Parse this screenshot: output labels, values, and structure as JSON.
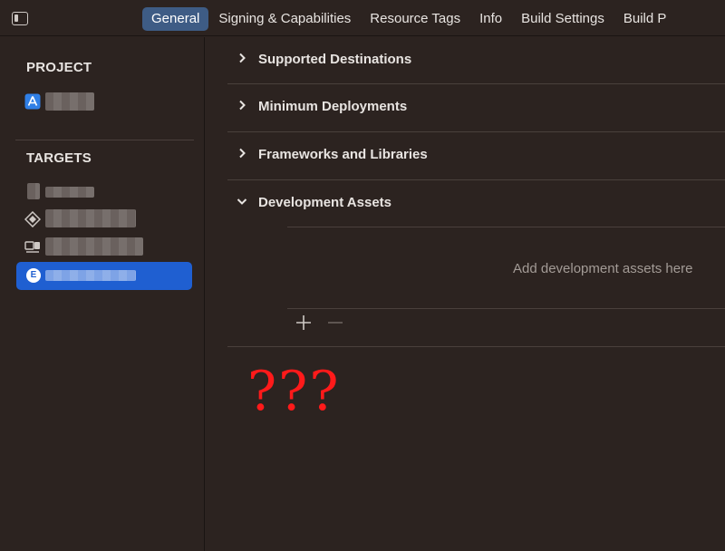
{
  "tabbar": {
    "tabs": [
      {
        "label": "General",
        "active": true
      },
      {
        "label": "Signing & Capabilities",
        "active": false
      },
      {
        "label": "Resource Tags",
        "active": false
      },
      {
        "label": "Info",
        "active": false
      },
      {
        "label": "Build Settings",
        "active": false
      },
      {
        "label": "Build P",
        "active": false
      }
    ]
  },
  "sidebar": {
    "project_header": "PROJECT",
    "targets_header": "TARGETS",
    "selected_target_badge": "E"
  },
  "main": {
    "sections": [
      {
        "label": "Supported Destinations",
        "expanded": false
      },
      {
        "label": "Minimum Deployments",
        "expanded": false
      },
      {
        "label": "Frameworks and Libraries",
        "expanded": false
      },
      {
        "label": "Development Assets",
        "expanded": true
      }
    ],
    "development_assets_empty": "Add development assets here",
    "annotation": "???"
  },
  "colors": {
    "accent_selected": "#1f5fd1",
    "tab_active": "#3e5c85",
    "annotation": "#ff1a1a"
  }
}
